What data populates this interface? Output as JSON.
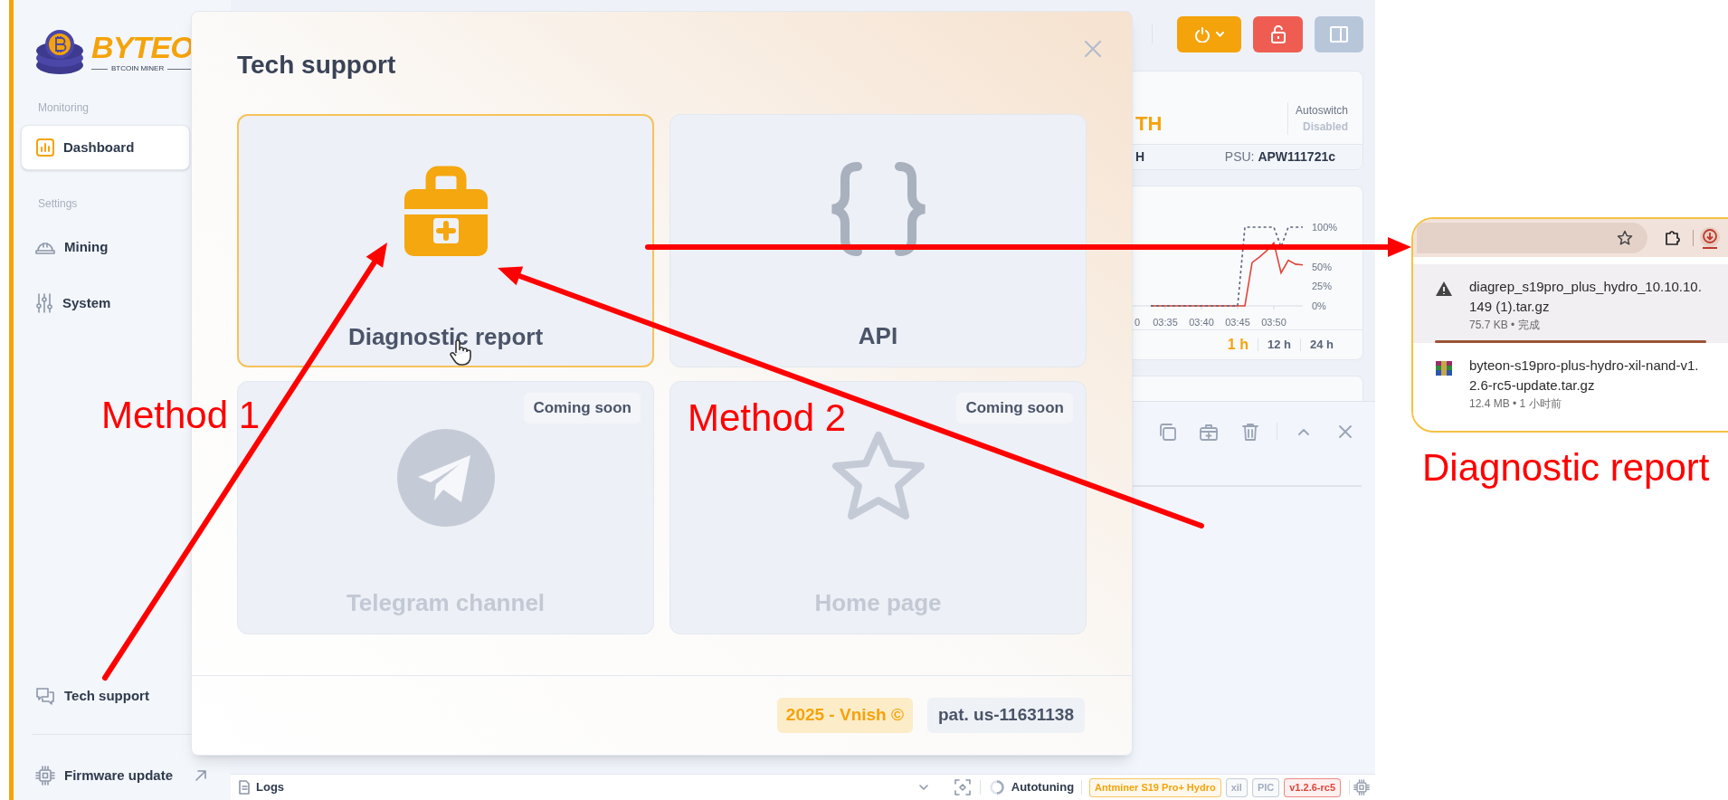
{
  "sidebar": {
    "logo": {
      "brand": "BYTEO",
      "tagline": "BTCOIN MINER"
    },
    "sections": [
      {
        "heading": "Monitoring",
        "items": [
          {
            "label": "Dashboard",
            "kind": "chart",
            "selected": true
          }
        ]
      },
      {
        "heading": "Settings",
        "items": [
          {
            "label": "Mining",
            "kind": "helmet",
            "selected": false
          },
          {
            "label": "System",
            "kind": "sliders",
            "selected": false
          }
        ]
      }
    ],
    "bottom_items": [
      {
        "label": "Tech support",
        "kind": "chat",
        "external": false
      },
      {
        "label": "Firmware update",
        "kind": "chip",
        "external": true
      }
    ]
  },
  "toolbar": {
    "buttons": [
      {
        "kind": "power"
      },
      {
        "kind": "unlock"
      },
      {
        "kind": "panel"
      }
    ]
  },
  "summary_card": {
    "hashrate_unit": "TH",
    "autoswitch_label": "Autoswitch",
    "autoswitch_value": "Disabled",
    "footer_left": "H",
    "psu": "PSU: **APW111721c**"
  },
  "chart_card": {
    "chart_data": {
      "type": "line",
      "categories": [
        "0",
        null,
        null,
        null,
        null,
        "03:35",
        null,
        null,
        null,
        null,
        "03:40",
        null,
        null,
        null,
        null,
        "03:45",
        null,
        null,
        null,
        null,
        "03:50",
        null,
        null,
        null,
        null
      ],
      "series": [
        {
          "color": "#e0453a",
          "line_style": "solid",
          "values": [
            null,
            null,
            null,
            0,
            0,
            0,
            0,
            0,
            0,
            0,
            0,
            0,
            0,
            0,
            0,
            0,
            0,
            55,
            62,
            70,
            80,
            42,
            58,
            53,
            52
          ]
        },
        {
          "color": "#5b6578",
          "line_style": "dashed",
          "values": [
            null,
            null,
            null,
            0,
            0,
            0,
            0,
            0,
            0,
            0,
            0,
            0,
            0,
            0,
            0,
            0,
            100,
            100,
            100,
            100,
            100,
            75,
            100,
            100,
            100
          ]
        }
      ],
      "ylim": [
        0,
        100
      ],
      "yticks": [
        {
          "value": 100,
          "label": "100%"
        },
        {
          "value": 50,
          "label": "50%"
        },
        {
          "value": 25,
          "label": "25%"
        },
        {
          "value": 0,
          "label": "0%"
        }
      ]
    },
    "ranges": [
      {
        "label": "1 h",
        "selected": true
      },
      {
        "label": "12 h",
        "selected": false
      },
      {
        "label": "24 h",
        "selected": false
      }
    ]
  },
  "log_panel": {
    "actions": [
      {
        "kind": "copy"
      },
      {
        "kind": "diagnostic"
      },
      {
        "kind": "delete"
      },
      {
        "kind": "collapse"
      },
      {
        "kind": "close"
      }
    ]
  },
  "status_bar": {
    "label": "Logs",
    "mode": "Autotuning",
    "badges": [
      {
        "text": "Antminer S19 Pro+ Hydro",
        "color": "#f5a30a"
      },
      {
        "text": "xil",
        "color": "#a3adbf"
      },
      {
        "text": "PIC",
        "color": "#a3adbf"
      },
      {
        "text": "v1.2.6-rc5",
        "color": "#e0453a"
      }
    ]
  },
  "modal": {
    "title": "Tech support",
    "cards": [
      {
        "label": "Diagnostic report",
        "kind": "kit",
        "selected": true,
        "disabled": false
      },
      {
        "label": "API",
        "kind": "braces",
        "selected": false,
        "disabled": false
      },
      {
        "label": "Telegram channel",
        "kind": "plane",
        "selected": false,
        "disabled": true,
        "badge": "Coming soon"
      },
      {
        "label": "Home page",
        "kind": "star",
        "selected": false,
        "disabled": true,
        "badge": "Coming soon"
      }
    ],
    "footer": {
      "copyright": "2025 - Vnish ©",
      "patent": "pat. us-11631138"
    }
  },
  "downloads": {
    "items": [
      {
        "name": "diagrep_s19pro_plus_hydro_10.10.10.149 (1).tar.gz",
        "meta": "75.7 KB • 完成",
        "kind": "warning",
        "selected": true
      },
      {
        "name": "byteon-s19pro-plus-hydro-xil-nand-v1.2.6-rc5-update.tar.gz",
        "meta": "12.4 MB • 1 小时前",
        "kind": "archive",
        "selected": false
      }
    ]
  },
  "annotations": [
    {
      "kind": "method",
      "text": "Method 1"
    },
    {
      "kind": "method",
      "text": "Method 2"
    },
    {
      "kind": "caption",
      "text": "Diagnostic report"
    }
  ]
}
